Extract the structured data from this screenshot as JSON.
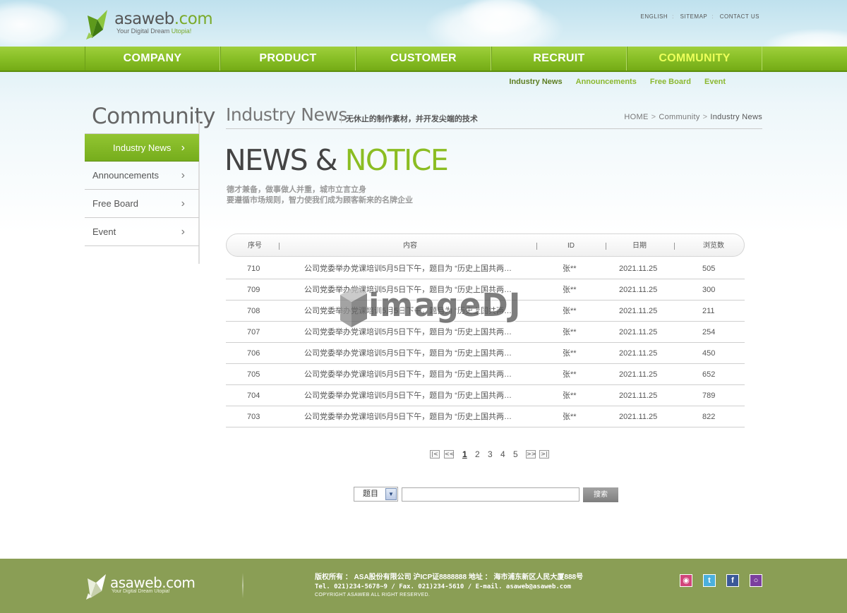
{
  "header": {
    "logo_text": "asaweb",
    "logo_domain": ".com",
    "logo_slogan": "Your Digital Dream ",
    "logo_slogan_hl": "Utopia!",
    "top_links": [
      "ENGLISH",
      "SITEMAP",
      "CONTACT US"
    ]
  },
  "nav": {
    "items": [
      "COMPANY",
      "PRODUCT",
      "CUSTOMER",
      "RECRUIT",
      "COMMUNITY"
    ],
    "active_index": 4
  },
  "subnav": {
    "items": [
      "Industry News",
      "Announcements",
      "Free Board",
      "Event"
    ],
    "active_index": 0
  },
  "sidebar": {
    "title": "Community",
    "items": [
      "Industry News",
      "Announcements",
      "Free Board",
      "Event"
    ],
    "active_index": 0
  },
  "content": {
    "page_title": "Industry News",
    "page_desc": "无休止的制作素材，并开发尖端的技术",
    "breadcrumb": [
      "HOME",
      "Community",
      "Industry News"
    ],
    "hero_dark": "NEWS & ",
    "hero_green": "NOTICE",
    "hero_sub1": "德才兼备，做事做人并重，城市立言立身",
    "hero_sub2": "要遵循市场规则，智力使我们成为顾客新来的名牌企业"
  },
  "table": {
    "headers": [
      "序号",
      "内容",
      "ID",
      "日期",
      "浏览数"
    ],
    "rows": [
      {
        "no": "710",
        "title": "公司党委举办党课培训5月5日下午，题目为 “历史上国共两…",
        "id": "张**",
        "date": "2021.11.25",
        "views": "505"
      },
      {
        "no": "709",
        "title": "公司党委举办党课培训5月5日下午，题目为 “历史上国共两…",
        "id": "张**",
        "date": "2021.11.25",
        "views": "300"
      },
      {
        "no": "708",
        "title": "公司党委举办党课培训5月5日下午，题目为 “历史上国共两…",
        "id": "张**",
        "date": "2021.11.25",
        "views": "211"
      },
      {
        "no": "707",
        "title": "公司党委举办党课培训5月5日下午，题目为 “历史上国共两…",
        "id": "张**",
        "date": "2021.11.25",
        "views": "254"
      },
      {
        "no": "706",
        "title": "公司党委举办党课培训5月5日下午，题目为 “历史上国共两…",
        "id": "张**",
        "date": "2021.11.25",
        "views": "450"
      },
      {
        "no": "705",
        "title": "公司党委举办党课培训5月5日下午，题目为 “历史上国共两…",
        "id": "张**",
        "date": "2021.11.25",
        "views": "652"
      },
      {
        "no": "704",
        "title": "公司党委举办党课培训5月5日下午，题目为 “历史上国共两…",
        "id": "张**",
        "date": "2021.11.25",
        "views": "789"
      },
      {
        "no": "703",
        "title": "公司党委举办党课培训5月5日下午，题目为 “历史上国共两…",
        "id": "张**",
        "date": "2021.11.25",
        "views": "822"
      }
    ]
  },
  "pagination": {
    "pages": [
      "1",
      "2",
      "3",
      "4",
      "5"
    ],
    "current": "1"
  },
  "search": {
    "field_label": "题目",
    "input_value": "",
    "button_label": "搜索"
  },
  "watermark": {
    "text": "imageDJ"
  },
  "footer": {
    "logo_text": "asaweb",
    "logo_domain": ".com",
    "logo_slogan": "Your Digital Dream Utopia!",
    "line1": "版权所有 ： ASA股份有限公司 沪ICP证8888888     地址 ： 海市浦东新区人民大厦888号",
    "line2": "Tel. 021)234-5678~9  / Fax. 021)234-5610  / E-mail. asaweb@asaweb.com",
    "line3": "COPYRIGHT ASAWEB ALL RIGHT RESERVED."
  },
  "colors": {
    "brand_green": "#88bf26",
    "active_nav_text": "#ecff5a",
    "footer_bg": "#8a9e55"
  }
}
